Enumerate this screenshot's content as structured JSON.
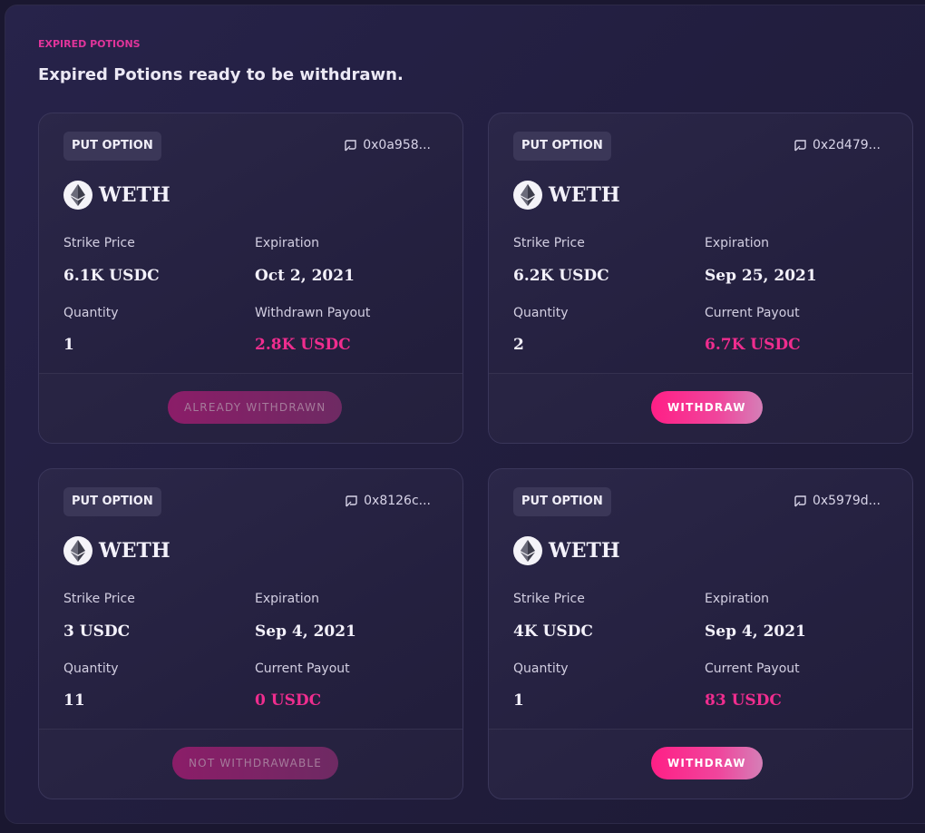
{
  "section": {
    "eyebrow": "EXPIRED POTIONS",
    "heading": "Expired Potions ready to be withdrawn."
  },
  "icons": {
    "address": "external-link-icon",
    "asset": "ethereum-icon"
  },
  "colors": {
    "accent": "#ef2d8e",
    "eyebrow": "#e0349a",
    "background": "#1a1730"
  },
  "cards": [
    {
      "type": "PUT OPTION",
      "address": "0x0a958...",
      "asset": "WETH",
      "strike_label": "Strike Price",
      "strike": "6.1K USDC",
      "expiration_label": "Expiration",
      "expiration": "Oct 2, 2021",
      "quantity_label": "Quantity",
      "quantity": "1",
      "payout_label": "Withdrawn Payout",
      "payout": "2.8K USDC",
      "button": "ALREADY WITHDRAWN",
      "button_state": "disabled"
    },
    {
      "type": "PUT OPTION",
      "address": "0x2d479...",
      "asset": "WETH",
      "strike_label": "Strike Price",
      "strike": "6.2K USDC",
      "expiration_label": "Expiration",
      "expiration": "Sep 25, 2021",
      "quantity_label": "Quantity",
      "quantity": "2",
      "payout_label": "Current Payout",
      "payout": "6.7K USDC",
      "button": "WITHDRAW",
      "button_state": "active"
    },
    {
      "type": "PUT OPTION",
      "address": "0x8126c...",
      "asset": "WETH",
      "strike_label": "Strike Price",
      "strike": "3 USDC",
      "expiration_label": "Expiration",
      "expiration": "Sep 4, 2021",
      "quantity_label": "Quantity",
      "quantity": "11",
      "payout_label": "Current Payout",
      "payout": "0 USDC",
      "button": "NOT WITHDRAWABLE",
      "button_state": "disabled"
    },
    {
      "type": "PUT OPTION",
      "address": "0x5979d...",
      "asset": "WETH",
      "strike_label": "Strike Price",
      "strike": "4K USDC",
      "expiration_label": "Expiration",
      "expiration": "Sep 4, 2021",
      "quantity_label": "Quantity",
      "quantity": "1",
      "payout_label": "Current Payout",
      "payout": "83 USDC",
      "button": "WITHDRAW",
      "button_state": "active"
    }
  ]
}
